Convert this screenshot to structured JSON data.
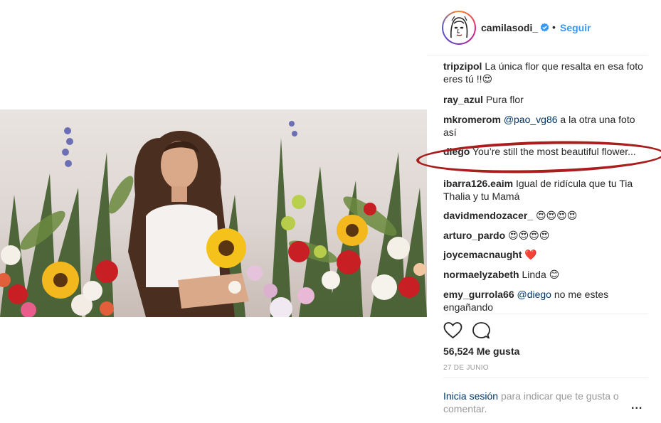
{
  "post": {
    "photo_alt": ""
  },
  "header": {
    "username": "camilasodi_",
    "separator": "•",
    "follow_label": "Seguir"
  },
  "comments": [
    {
      "user": "tripzipol",
      "text": "La única flor que resalta en esa foto eres tú !!😍"
    },
    {
      "user": "ray_azul",
      "text": "Pura flor"
    },
    {
      "user": "mkromerom",
      "mention": "@pao_vg86",
      "text": "a la otra una foto así"
    },
    {
      "user": "diego",
      "text": "You’re still the most beautiful flower..."
    },
    {
      "user": "ibarra126.eaim",
      "text": "Igual de ridícula que tu Tia Thalia y tu Mamá"
    },
    {
      "user": "davidmendozacer_",
      "text": "😍😍😍😍"
    },
    {
      "user": "arturo_pardo",
      "text": "😍😍😍😍"
    },
    {
      "user": "joycemacnaught",
      "text": "❤️"
    },
    {
      "user": "normaelyzabeth",
      "text": "Linda 😊"
    },
    {
      "user": "emy_gurrola66",
      "mention": "@diego",
      "text": "no me estes engañando"
    }
  ],
  "actions": {
    "like_icon": "heart-outline-icon",
    "comment_icon": "speech-bubble-icon"
  },
  "stats": {
    "likes": "56,524 Me gusta",
    "date": "27 DE JUNIO"
  },
  "footer": {
    "login_link": "Inicia sesión",
    "login_text": "para indicar que te gusta o comentar.",
    "more": "..."
  },
  "colors": {
    "link_blue": "#3897f0",
    "mention_blue": "#003569",
    "highlight_red": "#a91d1d",
    "muted": "#999999"
  }
}
